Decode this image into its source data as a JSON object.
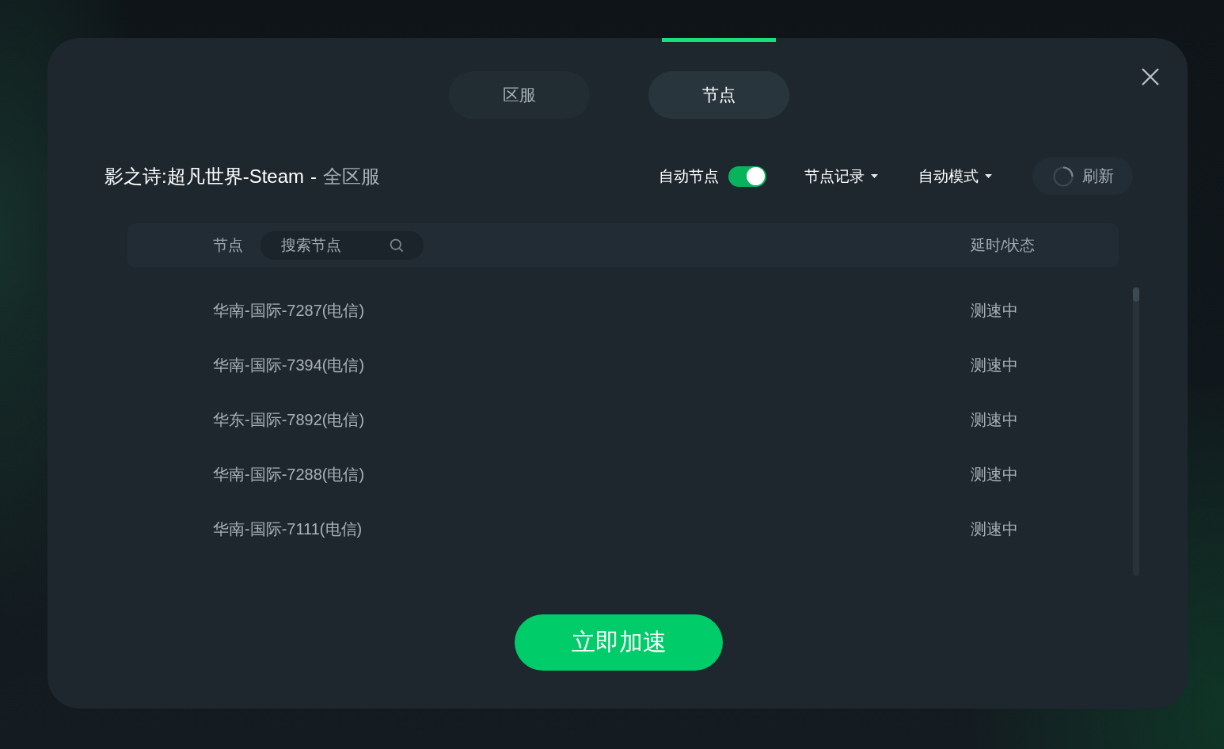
{
  "tabs": [
    {
      "label": "区服",
      "selected": false
    },
    {
      "label": "节点",
      "selected": true
    }
  ],
  "header": {
    "game": "影之诗:超凡世界-Steam",
    "separator": "-",
    "region": "全区服"
  },
  "toolbar": {
    "auto_node": {
      "label": "自动节点",
      "on": true
    },
    "dropdowns": [
      {
        "label": "节点记录"
      },
      {
        "label": "自动模式"
      }
    ],
    "refresh": {
      "label": "刷新"
    }
  },
  "table": {
    "columns": [
      "节点",
      "延时/状态"
    ],
    "search": {
      "placeholder": "搜索节点"
    },
    "rows": [
      {
        "node": "华南-国际-7287(电信)",
        "status": "测速中"
      },
      {
        "node": "华南-国际-7394(电信)",
        "status": "测速中"
      },
      {
        "node": "华东-国际-7892(电信)",
        "status": "测速中"
      },
      {
        "node": "华南-国际-7288(电信)",
        "status": "测速中"
      },
      {
        "node": "华南-国际-7111(电信)",
        "status": "测速中"
      }
    ]
  },
  "start_button": {
    "label": "立即加速"
  }
}
